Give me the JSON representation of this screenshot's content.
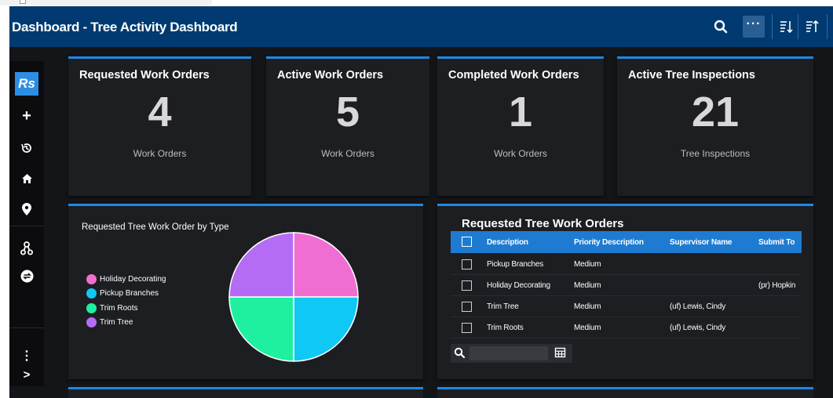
{
  "header": {
    "title": "Dashboard - Tree Activity Dashboard",
    "more_label": "···"
  },
  "sidebar": {
    "logo": "Rs"
  },
  "cards": [
    {
      "title": "Requested Work Orders",
      "value": "4",
      "subtitle": "Work Orders"
    },
    {
      "title": "Active Work Orders",
      "value": "5",
      "subtitle": "Work Orders"
    },
    {
      "title": "Completed Work Orders",
      "value": "1",
      "subtitle": "Work Orders"
    },
    {
      "title": "Active Tree Inspections",
      "value": "21",
      "subtitle": "Tree Inspections"
    }
  ],
  "pie_card": {
    "title": "Requested Tree Work Order by Type",
    "legend": [
      {
        "label": "Holiday Decorating",
        "color": "#f06ed2"
      },
      {
        "label": "Pickup Branches",
        "color": "#10c8f4"
      },
      {
        "label": "Trim Roots",
        "color": "#1ef0a0"
      },
      {
        "label": "Trim Tree",
        "color": "#b56cf5"
      }
    ]
  },
  "chart_data": {
    "type": "pie",
    "title": "Requested Tree Work Order by Type",
    "categories": [
      "Holiday Decorating",
      "Pickup Branches",
      "Trim Roots",
      "Trim Tree"
    ],
    "values": [
      1,
      1,
      1,
      1
    ],
    "colors": [
      "#f06ed2",
      "#10c8f4",
      "#1ef0a0",
      "#b56cf5"
    ]
  },
  "table": {
    "title": "Requested Tree Work Orders",
    "columns": [
      "Description",
      "Priority Description",
      "Supervisor Name",
      "Submit To"
    ],
    "rows": [
      [
        "Pickup Branches",
        "Medium",
        "",
        ""
      ],
      [
        "Holiday Decorating",
        "Medium",
        "",
        "(pr) Hopkin"
      ],
      [
        "Trim Tree",
        "Medium",
        "(uf) Lewis, Cindy",
        ""
      ],
      [
        "Trim Roots",
        "Medium",
        "(uf) Lewis, Cindy",
        ""
      ]
    ],
    "search_placeholder": "",
    "pager": "· · · · · ·"
  }
}
